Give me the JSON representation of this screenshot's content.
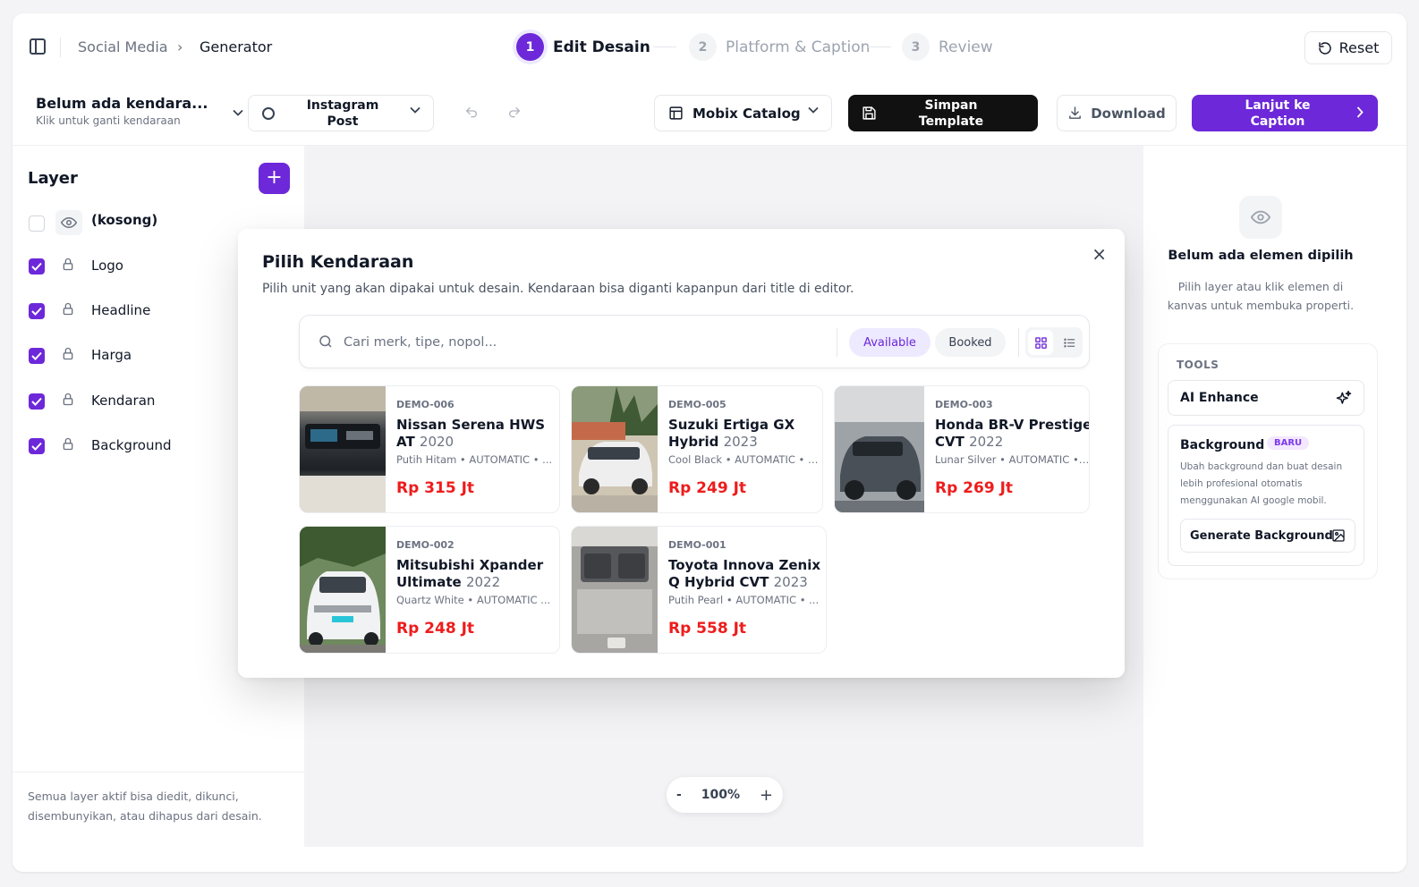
{
  "breadcrumb": {
    "parent": "Social Media",
    "separator": "›",
    "current": "Generator"
  },
  "steps": [
    {
      "num": "1",
      "label": "Edit Desain",
      "state": "active"
    },
    {
      "num": "2",
      "label": "Platform & Caption",
      "state": "inactive"
    },
    {
      "num": "3",
      "label": "Review",
      "state": "inactive"
    }
  ],
  "reset_label": "Reset",
  "toolbar": {
    "vehicle_title": "Belum ada kendara...",
    "vehicle_sub": "Klik untuk ganti kendaraan",
    "format_label": "Instagram Post",
    "catalog_label": "Mobix Catalog",
    "save_label": "Simpan Template",
    "download_label": "Download",
    "next_label": "Lanjut ke Caption"
  },
  "layers": {
    "title": "Layer",
    "add": "+",
    "items": [
      {
        "label": "(kosong)",
        "checked": false,
        "icon": "eye-icon"
      },
      {
        "label": "Logo",
        "checked": true,
        "icon": "lock-icon"
      },
      {
        "label": "Headline",
        "checked": true,
        "icon": "lock-icon"
      },
      {
        "label": "Harga",
        "checked": true,
        "icon": "lock-icon"
      },
      {
        "label": "Kendaran",
        "checked": true,
        "icon": "lock-icon"
      },
      {
        "label": "Background",
        "checked": true,
        "icon": "lock-icon"
      }
    ],
    "footer": "Semua layer aktif bisa diedit, dikunci, disembunyikan, atau dihapus dari desain."
  },
  "zoom": {
    "minus": "-",
    "value": "100%",
    "plus": "+"
  },
  "properties": {
    "empty_title": "Belum ada elemen dipilih",
    "empty_desc": "Pilih layer atau klik elemen di kanvas untuk membuka properti.",
    "tools_heading": "TOOLS",
    "ai_enhance": "AI Enhance",
    "background_title": "Background",
    "background_badge": "BARU",
    "background_desc": "Ubah background dan buat desain lebih profesional otomatis menggunakan AI google mobil.",
    "generate_label": "Generate Background"
  },
  "modal": {
    "title": "Pilih Kendaraan",
    "subtitle": "Pilih unit yang akan dipakai untuk desain. Kendaraan bisa diganti kapanpun dari title di editor.",
    "close": "×",
    "search_placeholder": "Cari merk, tipe, nopol...",
    "filter_available": "Available",
    "filter_booked": "Booked",
    "vehicles": [
      {
        "code": "DEMO-006",
        "name": "Nissan Serena HWS AT",
        "year": "2020",
        "meta": "Putih Hitam • AUTOMATIC • ...",
        "price": "Rp 315 Jt"
      },
      {
        "code": "DEMO-005",
        "name": "Suzuki Ertiga GX Hybrid",
        "year": "2023",
        "meta": "Cool Black • AUTOMATIC • U...",
        "price": "Rp 249 Jt"
      },
      {
        "code": "DEMO-003",
        "name": "Honda BR-V Prestige CVT",
        "year": "2022",
        "meta": "Lunar Silver • AUTOMATIC • ...",
        "price": "Rp 269 Jt"
      },
      {
        "code": "DEMO-002",
        "name": "Mitsubishi Xpander Ultimate",
        "year": "2022",
        "meta": "Quartz White • AUTOMATIC ...",
        "price": "Rp 248 Jt"
      },
      {
        "code": "DEMO-001",
        "name": "Toyota Innova Zenix Q Hybrid CVT",
        "year": "2023",
        "meta": "Putih Pearl • AUTOMATIC • ...",
        "price": "Rp 558 Jt"
      }
    ]
  },
  "colors": {
    "accent": "#6d28d9",
    "price": "#ee1c1c",
    "dark_button": "#111111"
  }
}
